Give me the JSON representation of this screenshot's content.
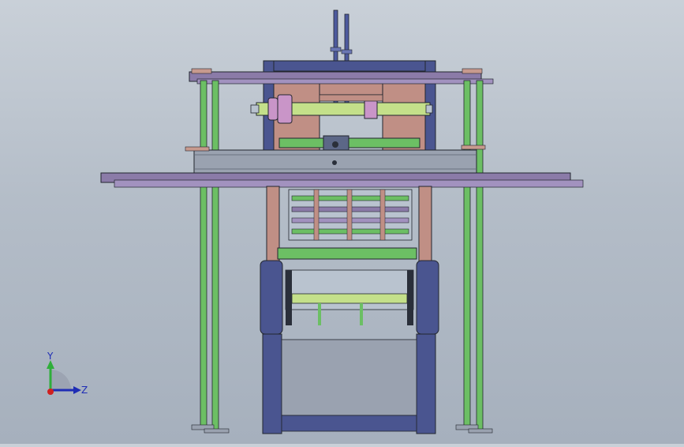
{
  "viewport": {
    "background_top": "#c9d0d8",
    "background_bottom": "#a6b0bd"
  },
  "triad": {
    "y_label": "Y",
    "z_label": "Z",
    "y_color": "#2fae3a",
    "z_color": "#1f2db5",
    "x_color": "#d02020"
  },
  "model": {
    "colors": {
      "column_green": "#6cbf64",
      "beam_purple": "#8b7ba8",
      "frame_navy": "#4a5590",
      "plate_salmon": "#c79a8e",
      "shaft_lime": "#c4e08a",
      "gray_plate": "#9aa2b0",
      "dark_edge": "#22262e"
    }
  }
}
